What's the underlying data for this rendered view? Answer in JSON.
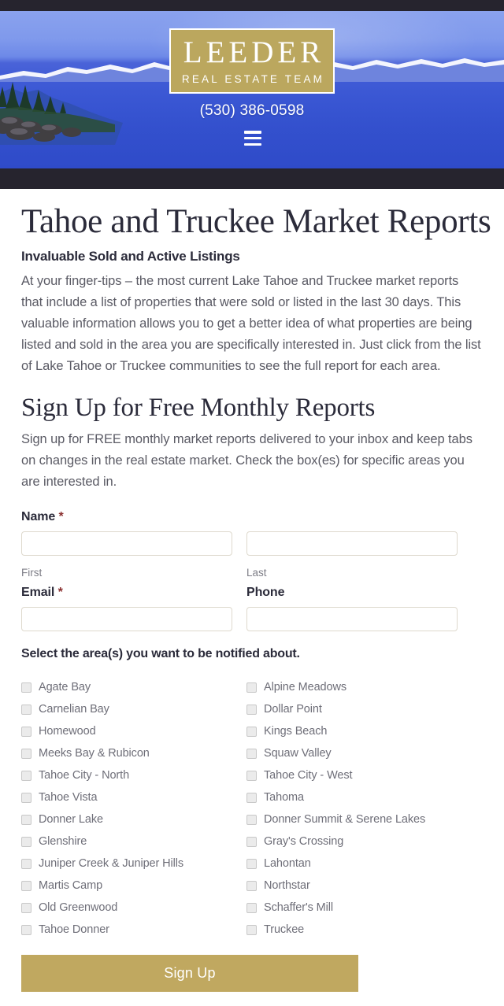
{
  "header": {
    "logo_main": "LEEDER",
    "logo_sub": "REAL ESTATE TEAM",
    "phone": "(530) 386-0598",
    "menu_icon": "hamburger-menu-icon",
    "logo_bg_color": "#bba75e"
  },
  "main": {
    "page_title": "Tahoe and Truckee Market Reports",
    "sub_head": "Invaluable Sold and Active Listings",
    "intro_paragraph": "At your finger-tips – the most current Lake Tahoe and Truckee market reports that include a list of properties that were sold or listed in the last 30 days. This valuable information allows you to get a better idea of what properties are being listed and sold in the area you are specifically interested in. Just click from the list of Lake Tahoe or Truckee communities to see the full report for each area.",
    "section_title": "Sign Up for Free Monthly Reports",
    "signup_paragraph": "Sign up for FREE monthly market reports delivered to your inbox and keep tabs on changes in the real estate market. Check the box(es) for specific areas you are interested in."
  },
  "form": {
    "name_label": "Name",
    "name_required": "*",
    "first_sub_label": "First",
    "last_sub_label": "Last",
    "first_value": "",
    "last_value": "",
    "email_label": "Email",
    "email_required": "*",
    "phone_label": "Phone",
    "email_value": "",
    "phone_value": "",
    "checkbox_title": "Select the area(s) you want to be notified about.",
    "areas_left": [
      "Agate Bay",
      "Carnelian Bay",
      "Homewood",
      "Meeks Bay & Rubicon",
      "Tahoe City - North",
      "Tahoe Vista",
      "Donner Lake",
      "Glenshire",
      "Juniper Creek & Juniper Hills",
      "Martis Camp",
      "Old Greenwood",
      "Tahoe Donner"
    ],
    "areas_right": [
      "Alpine Meadows",
      "Dollar Point",
      "Kings Beach",
      "Squaw Valley",
      "Tahoe City - West",
      "Tahoma",
      "Donner Summit & Serene Lakes",
      "Gray's Crossing",
      "Lahontan",
      "Northstar",
      "Schaffer's Mill",
      "Truckee"
    ],
    "submit_label": "Sign Up",
    "submit_color": "#c0a860"
  }
}
